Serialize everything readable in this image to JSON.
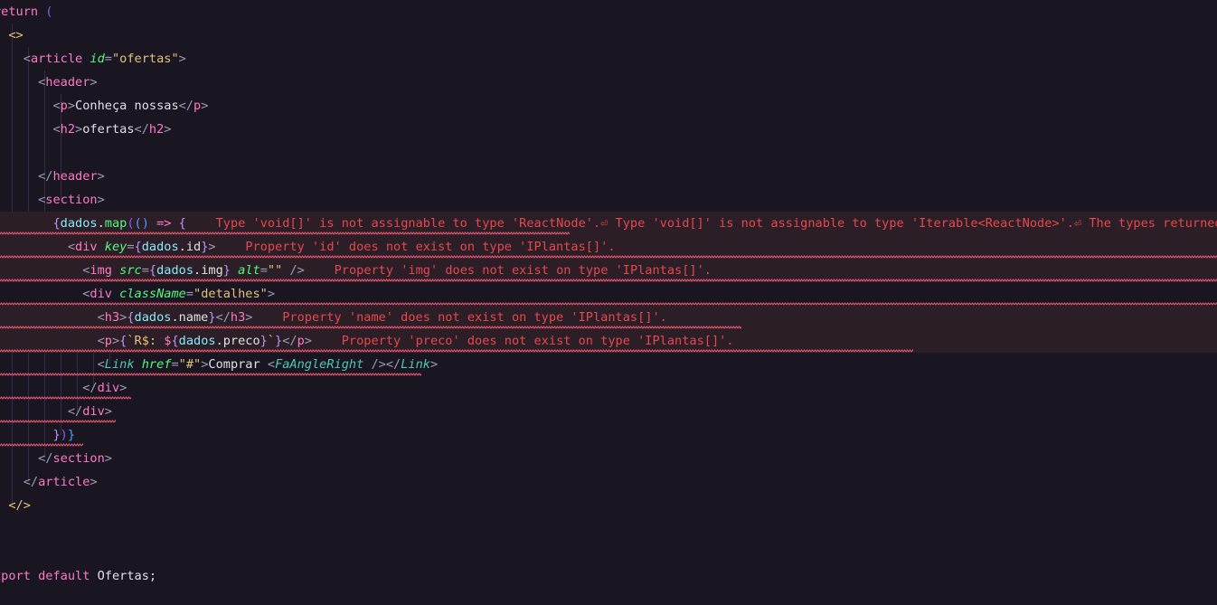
{
  "editor": {
    "language": "tsx",
    "theme_background": "#191622",
    "error_line_background": "#2c1e26",
    "squiggle_color": "#e5576f",
    "diagnostic_color": "#e5484d",
    "indent_guide_color": "#3b3550",
    "line_height_px": 26,
    "horizontal_scroll": "scrolled-right",
    "first_visible_line_truncated_prefix": "e"
  },
  "code": {
    "lines": [
      {
        "n": 1,
        "indent": 0,
        "text": "return (",
        "error": false
      },
      {
        "n": 2,
        "indent": 1,
        "text": "<>",
        "error": false
      },
      {
        "n": 3,
        "indent": 2,
        "text": "<article id=\"ofertas\">",
        "error": false
      },
      {
        "n": 4,
        "indent": 3,
        "text": "<header>",
        "error": false
      },
      {
        "n": 5,
        "indent": 4,
        "text": "<p>Conheça nossas</p>",
        "error": false
      },
      {
        "n": 6,
        "indent": 4,
        "text": "<h2>ofertas</h2>",
        "error": false
      },
      {
        "n": 7,
        "indent": 4,
        "text": "",
        "error": false
      },
      {
        "n": 8,
        "indent": 3,
        "text": "</header>",
        "error": false
      },
      {
        "n": 9,
        "indent": 3,
        "text": "<section>",
        "error": false
      },
      {
        "n": 10,
        "indent": 4,
        "text": "{dados.map(() => {",
        "error": true
      },
      {
        "n": 11,
        "indent": 5,
        "text": "<div key={dados.id}>",
        "error": true
      },
      {
        "n": 12,
        "indent": 6,
        "text": "<img src={dados.img} alt=\"\" />",
        "error": true
      },
      {
        "n": 13,
        "indent": 6,
        "text": "<div className=\"detalhes\">",
        "error": false
      },
      {
        "n": 14,
        "indent": 7,
        "text": "<h3>{dados.name}</h3>",
        "error": true
      },
      {
        "n": 15,
        "indent": 7,
        "text": "<p>{`R$: ${dados.preco}`}</p>",
        "error": true
      },
      {
        "n": 16,
        "indent": 7,
        "text": "<Link href=\"#\">Comprar <FaAngleRight /></Link>",
        "error": false
      },
      {
        "n": 17,
        "indent": 6,
        "text": "</div>",
        "error": false
      },
      {
        "n": 18,
        "indent": 5,
        "text": "</div>",
        "error": false
      },
      {
        "n": 19,
        "indent": 4,
        "text": "})}",
        "error": false
      },
      {
        "n": 20,
        "indent": 3,
        "text": "</section>",
        "error": false
      },
      {
        "n": 21,
        "indent": 2,
        "text": "</article>",
        "error": false
      },
      {
        "n": 22,
        "indent": 1,
        "text": "</>",
        "error": false
      },
      {
        "n": 23,
        "indent": 0,
        "text": ")",
        "error": false
      },
      {
        "n": 24,
        "indent": 0,
        "text": "",
        "error": false
      },
      {
        "n": 25,
        "indent": 0,
        "text": "export default Ofertas;",
        "error": false
      }
    ]
  },
  "diagnostics": [
    {
      "line": 10,
      "message": "Type 'void[]' is not assignable to type 'ReactNode'.⏎ Type 'void[]' is not assignable to type 'Iterable<ReactNode>'.⏎ The types returned by '[Sy",
      "truncated": true
    },
    {
      "line": 11,
      "message": "Property 'id' does not exist on type 'IPlantas[]'.",
      "truncated": false
    },
    {
      "line": 12,
      "message": "Property 'img' does not exist on type 'IPlantas[]'.",
      "truncated": false
    },
    {
      "line": 14,
      "message": "Property 'name' does not exist on type 'IPlantas[]'.",
      "truncated": false
    },
    {
      "line": 15,
      "message": "Property 'preco' does not exist on type 'IPlantas[]'.",
      "truncated": false
    }
  ]
}
